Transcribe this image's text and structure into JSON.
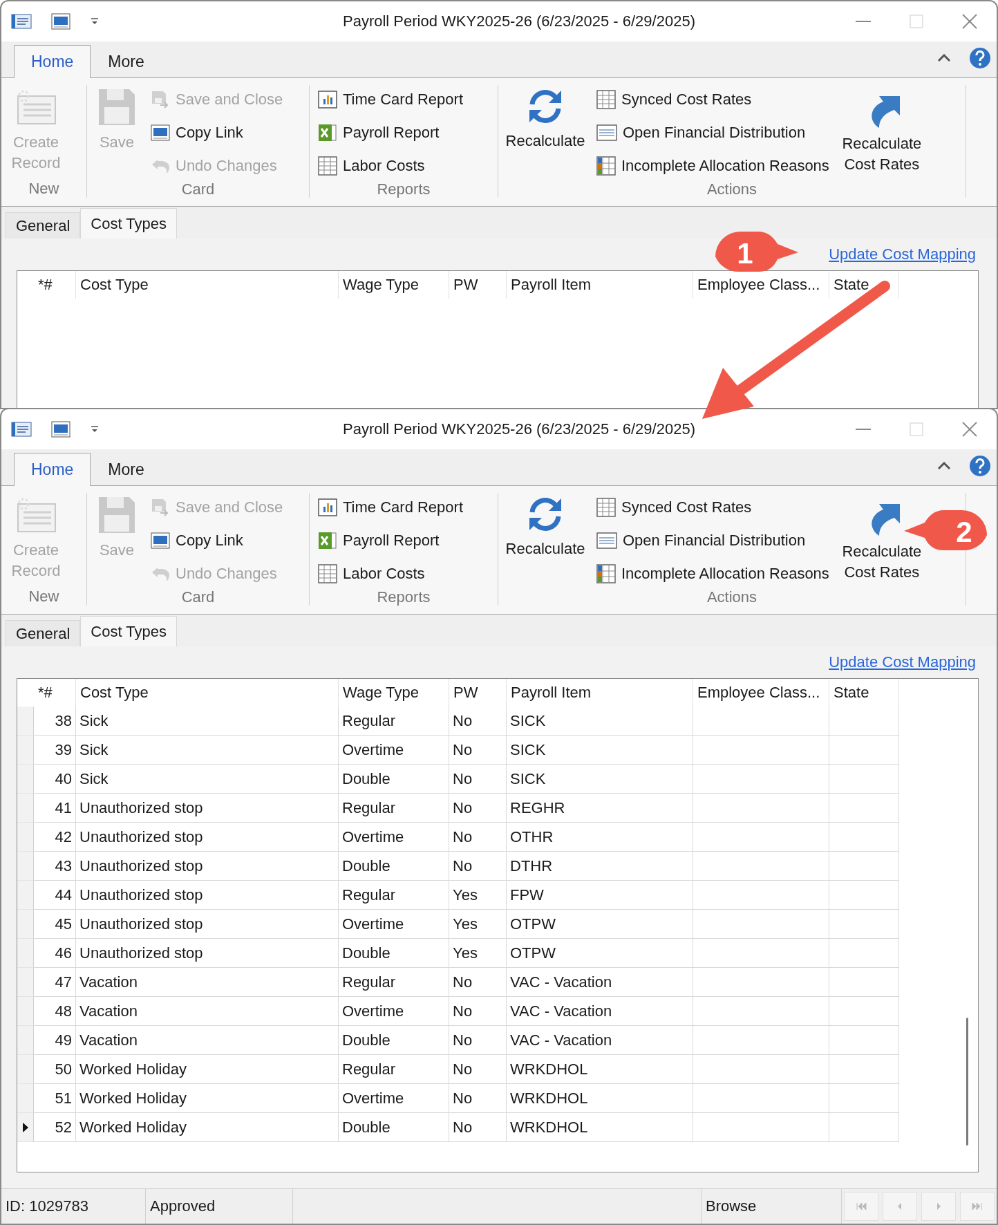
{
  "windows": [
    {
      "title": "Payroll Period WKY2025-26 (6/23/2025 - 6/29/2025)",
      "ribbon_tabs": [
        {
          "label": "Home",
          "selected": true
        },
        {
          "label": "More",
          "selected": false
        }
      ],
      "ribbon_groups": [
        {
          "label": "New",
          "items": [
            {
              "label": "Create Record",
              "kind": "large",
              "disabled": true
            }
          ]
        },
        {
          "label": "Card",
          "items": [
            {
              "label": "Save",
              "kind": "large",
              "disabled": true
            },
            {
              "label": "Save and Close",
              "kind": "small",
              "disabled": true
            },
            {
              "label": "Copy Link",
              "kind": "small",
              "disabled": false
            },
            {
              "label": "Undo Changes",
              "kind": "small",
              "disabled": true
            }
          ]
        },
        {
          "label": "Reports",
          "items": [
            {
              "label": "Time Card Report",
              "kind": "small",
              "disabled": false
            },
            {
              "label": "Payroll Report",
              "kind": "small",
              "disabled": false
            },
            {
              "label": "Labor Costs",
              "kind": "small",
              "disabled": false
            }
          ]
        },
        {
          "label": "Actions",
          "items": [
            {
              "label": "Recalculate",
              "kind": "large",
              "disabled": false
            },
            {
              "label": "Synced Cost Rates",
              "kind": "small",
              "disabled": false
            },
            {
              "label": "Open Financial Distribution",
              "kind": "small",
              "disabled": false
            },
            {
              "label": "Incomplete Allocation Reasons",
              "kind": "small",
              "disabled": false
            },
            {
              "label": "Recalculate Cost Rates",
              "kind": "large",
              "disabled": false
            }
          ]
        }
      ],
      "form_tabs": [
        {
          "label": "General",
          "selected": false
        },
        {
          "label": "Cost Types",
          "selected": true
        }
      ],
      "link": "Update Cost Mapping",
      "columns": [
        "*#",
        "Cost Type",
        "Wage Type",
        "PW",
        "Payroll Item",
        "Employee Class...",
        "State"
      ]
    },
    {
      "title": "Payroll Period WKY2025-26 (6/23/2025 - 6/29/2025)",
      "ribbon_tabs": [
        {
          "label": "Home",
          "selected": true
        },
        {
          "label": "More",
          "selected": false
        }
      ],
      "ribbon_groups": [
        {
          "label": "New",
          "items": [
            {
              "label": "Create Record",
              "kind": "large",
              "disabled": true
            }
          ]
        },
        {
          "label": "Card",
          "items": [
            {
              "label": "Save",
              "kind": "large",
              "disabled": true
            },
            {
              "label": "Save and Close",
              "kind": "small",
              "disabled": true
            },
            {
              "label": "Copy Link",
              "kind": "small",
              "disabled": false
            },
            {
              "label": "Undo Changes",
              "kind": "small",
              "disabled": true
            }
          ]
        },
        {
          "label": "Reports",
          "items": [
            {
              "label": "Time Card Report",
              "kind": "small",
              "disabled": false
            },
            {
              "label": "Payroll Report",
              "kind": "small",
              "disabled": false
            },
            {
              "label": "Labor Costs",
              "kind": "small",
              "disabled": false
            }
          ]
        },
        {
          "label": "Actions",
          "items": [
            {
              "label": "Recalculate",
              "kind": "large",
              "disabled": false
            },
            {
              "label": "Synced Cost Rates",
              "kind": "small",
              "disabled": false
            },
            {
              "label": "Open Financial Distribution",
              "kind": "small",
              "disabled": false
            },
            {
              "label": "Incomplete Allocation Reasons",
              "kind": "small",
              "disabled": false
            },
            {
              "label": "Recalculate Cost Rates",
              "kind": "large",
              "disabled": false
            }
          ]
        }
      ],
      "form_tabs": [
        {
          "label": "General",
          "selected": false
        },
        {
          "label": "Cost Types",
          "selected": true
        }
      ],
      "link": "Update Cost Mapping",
      "columns": [
        "*#",
        "Cost Type",
        "Wage Type",
        "PW",
        "Payroll Item",
        "Employee Class...",
        "State"
      ],
      "rows": [
        {
          "number": "38",
          "cost_type": "Sick",
          "wage_type": "Regular",
          "pw": "No",
          "payroll_item": "SICK",
          "current": false
        },
        {
          "number": "39",
          "cost_type": "Sick",
          "wage_type": "Overtime",
          "pw": "No",
          "payroll_item": "SICK",
          "current": false
        },
        {
          "number": "40",
          "cost_type": "Sick",
          "wage_type": "Double",
          "pw": "No",
          "payroll_item": "SICK",
          "current": false
        },
        {
          "number": "41",
          "cost_type": "Unauthorized stop",
          "wage_type": "Regular",
          "pw": "No",
          "payroll_item": "REGHR",
          "current": false
        },
        {
          "number": "42",
          "cost_type": "Unauthorized stop",
          "wage_type": "Overtime",
          "pw": "No",
          "payroll_item": "OTHR",
          "current": false
        },
        {
          "number": "43",
          "cost_type": "Unauthorized stop",
          "wage_type": "Double",
          "pw": "No",
          "payroll_item": "DTHR",
          "current": false
        },
        {
          "number": "44",
          "cost_type": "Unauthorized stop",
          "wage_type": "Regular",
          "pw": "Yes",
          "payroll_item": "FPW",
          "current": false
        },
        {
          "number": "45",
          "cost_type": "Unauthorized stop",
          "wage_type": "Overtime",
          "pw": "Yes",
          "payroll_item": "OTPW",
          "current": false
        },
        {
          "number": "46",
          "cost_type": "Unauthorized stop",
          "wage_type": "Double",
          "pw": "Yes",
          "payroll_item": "OTPW",
          "current": false
        },
        {
          "number": "47",
          "cost_type": "Vacation",
          "wage_type": "Regular",
          "pw": "No",
          "payroll_item": "VAC - Vacation",
          "current": false
        },
        {
          "number": "48",
          "cost_type": "Vacation",
          "wage_type": "Overtime",
          "pw": "No",
          "payroll_item": "VAC - Vacation",
          "current": false
        },
        {
          "number": "49",
          "cost_type": "Vacation",
          "wage_type": "Double",
          "pw": "No",
          "payroll_item": "VAC - Vacation",
          "current": false
        },
        {
          "number": "50",
          "cost_type": "Worked Holiday",
          "wage_type": "Regular",
          "pw": "No",
          "payroll_item": "WRKDHOL",
          "current": false
        },
        {
          "number": "51",
          "cost_type": "Worked Holiday",
          "wage_type": "Overtime",
          "pw": "No",
          "payroll_item": "WRKDHOL",
          "current": false
        },
        {
          "number": "52",
          "cost_type": "Worked Holiday",
          "wage_type": "Double",
          "pw": "No",
          "payroll_item": "WRKDHOL",
          "current": true
        }
      ],
      "status_bar": {
        "id": "ID: 1029783",
        "status": "Approved",
        "mode": "Browse"
      }
    }
  ],
  "annotations": [
    {
      "label": "1"
    },
    {
      "label": "2"
    }
  ]
}
